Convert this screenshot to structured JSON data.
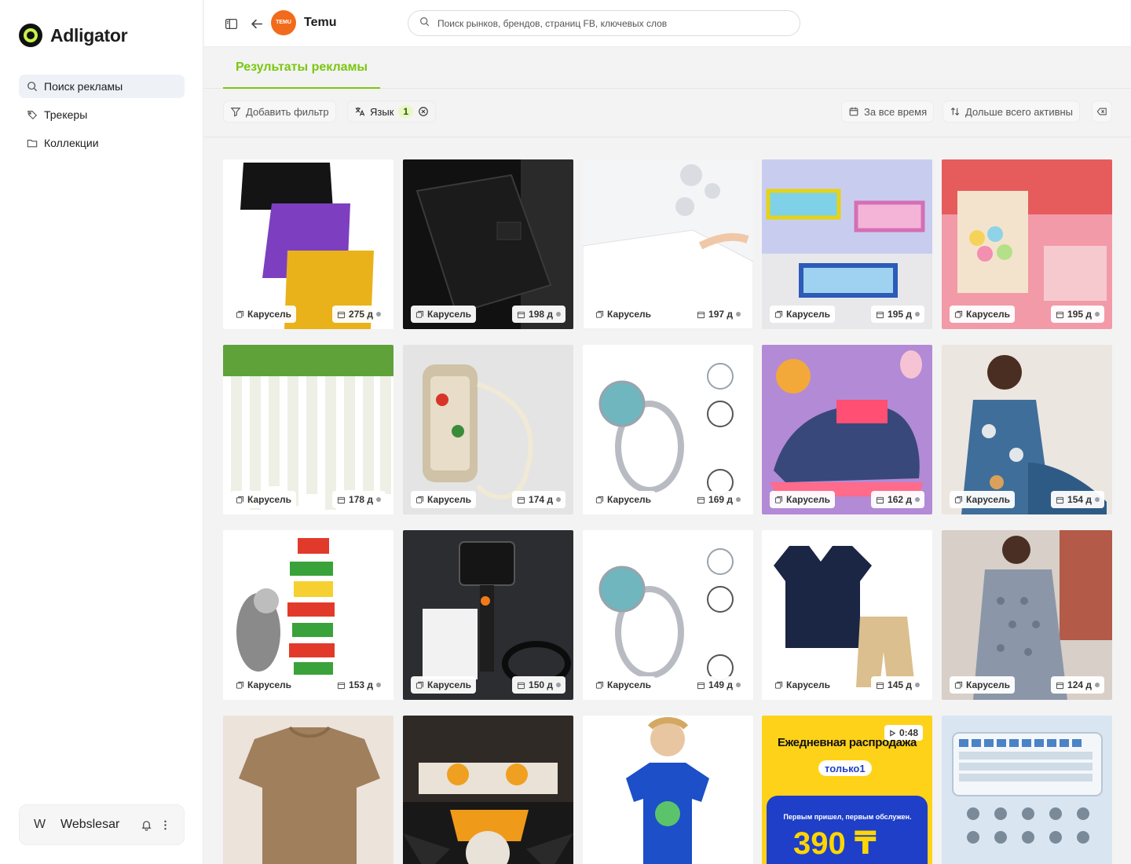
{
  "app": {
    "logo_text": "Adligator"
  },
  "sidebar": {
    "items": [
      {
        "label": "Поиск рекламы",
        "icon": "search-icon",
        "active": true
      },
      {
        "label": "Трекеры",
        "icon": "tag-icon",
        "active": false
      },
      {
        "label": "Коллекции",
        "icon": "folder-icon",
        "active": false
      }
    ],
    "user": {
      "initial": "W",
      "name": "Webslesar"
    }
  },
  "header": {
    "brand_name": "Temu",
    "brand_logo_text": "TEMU",
    "search_placeholder": "Поиск рынков, брендов, страниц FB, ключевых слов"
  },
  "tabs": [
    {
      "label": "Результаты рекламы",
      "active": true
    }
  ],
  "filters": {
    "add_filter": "Добавить фильтр",
    "language_label": "Язык",
    "language_count": "1",
    "period": "За все время",
    "sort": "Дольше всего активны"
  },
  "colors": {
    "accent": "#7ac70f",
    "brand": "#f26a1b",
    "promo_blue": "#1f3fc8",
    "promo_yellow": "#ffd600"
  },
  "ads": [
    {
      "type": "Карусель",
      "days": "275 д",
      "subject": "shorts"
    },
    {
      "type": "Карусель",
      "days": "198 д",
      "subject": "phone-wallet"
    },
    {
      "type": "Карусель",
      "days": "197 д",
      "subject": "mattress-cover"
    },
    {
      "type": "Карусель",
      "days": "195 д",
      "subject": "goggles"
    },
    {
      "type": "Карусель",
      "days": "195 д",
      "subject": "candy-bags"
    },
    {
      "type": "Карусель",
      "days": "178 д",
      "subject": "flowers"
    },
    {
      "type": "Карусель",
      "days": "174 д",
      "subject": "phone-case"
    },
    {
      "type": "Карусель",
      "days": "169 д",
      "subject": "ring"
    },
    {
      "type": "Карусель",
      "days": "162 д",
      "subject": "sneakers"
    },
    {
      "type": "Карусель",
      "days": "154 д",
      "subject": "pajamas"
    },
    {
      "type": "Карусель",
      "days": "153 д",
      "subject": "parrot-toy"
    },
    {
      "type": "Карусель",
      "days": "150 д",
      "subject": "endoscope"
    },
    {
      "type": "Карусель",
      "days": "149 д",
      "subject": "ring"
    },
    {
      "type": "Карусель",
      "days": "145 д",
      "subject": "baby-outfit"
    },
    {
      "type": "Карусель",
      "days": "124 д",
      "subject": "nightgown"
    },
    {
      "type": "",
      "days": "",
      "subject": "tshirt"
    },
    {
      "type": "",
      "days": "",
      "subject": "bedding"
    },
    {
      "type": "",
      "days": "",
      "subject": "kid-tshirt"
    },
    {
      "type": "",
      "days": "",
      "subject": "promo",
      "duration": "0:48",
      "promo_title": "Ежедневная распродажа",
      "promo_pill": "только1",
      "promo_sub": "Первым пришел, первым обслужен.",
      "promo_price": "390 ₸"
    },
    {
      "type": "",
      "days": "",
      "subject": "keyboard"
    }
  ]
}
